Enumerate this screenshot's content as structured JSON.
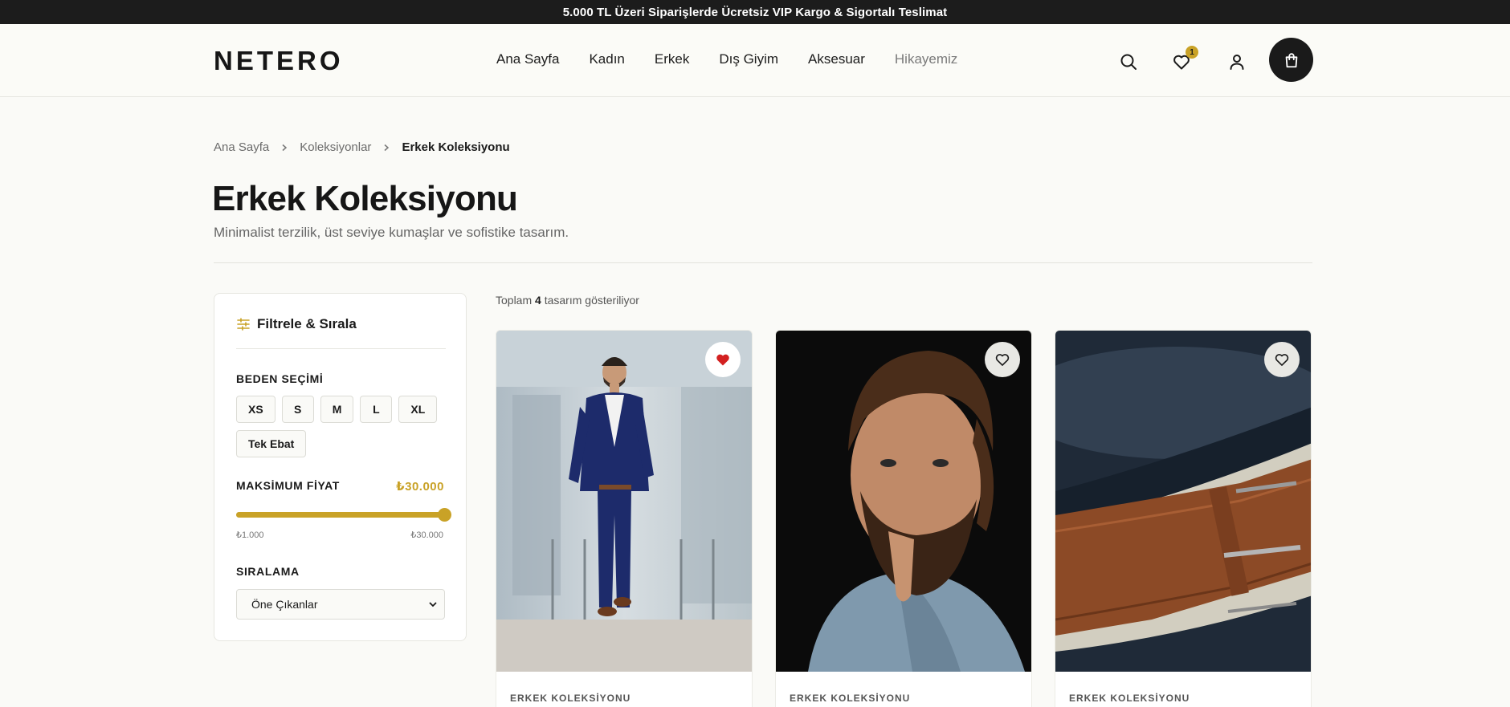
{
  "topbar": {
    "text": "5.000 TL Üzeri Siparişlerde Ücretsiz VIP Kargo & Sigortalı Teslimat"
  },
  "header": {
    "logo": "NETERO",
    "nav": [
      "Ana Sayfa",
      "Kadın",
      "Erkek",
      "Dış Giyim",
      "Aksesuar",
      "Hikayemiz"
    ],
    "wishlist_count": "1",
    "icons": [
      "search-icon",
      "heart-icon",
      "user-icon",
      "shopping-bag-icon"
    ]
  },
  "breadcrumb": [
    "Ana Sayfa",
    "Koleksiyonlar",
    "Erkek Koleksiyonu"
  ],
  "page": {
    "title": "Erkek Koleksiyonu",
    "subtitle": "Minimalist terzilik, üst seviye kumaşlar ve sofistike tasarım."
  },
  "filters": {
    "title": "Filtrele & Sırala",
    "size_label": "BEDEN SEÇİMİ",
    "sizes": [
      "XS",
      "S",
      "M",
      "L",
      "XL",
      "Tek Ebat"
    ],
    "price_label": "MAKSİMUM FİYAT",
    "price_value": "₺30.000",
    "price_fill_percent": 100,
    "price_min": "₺1.000",
    "price_max": "₺30.000",
    "sort_label": "SIRALAMA",
    "sort_selected": "Öne Çıkanlar"
  },
  "results": {
    "prefix": "Toplam",
    "count": "4",
    "suffix": "tasarım gösteriliyor"
  },
  "products": [
    {
      "category": "ERKEK KOLEKSİYONU",
      "favorite": true
    },
    {
      "category": "ERKEK KOLEKSİYONU",
      "favorite": false
    },
    {
      "category": "ERKEK KOLEKSİYONU",
      "favorite": false
    }
  ],
  "colors": {
    "accent": "#c9a227",
    "dark": "#1a1a1a",
    "favorite_red": "#d32020"
  }
}
